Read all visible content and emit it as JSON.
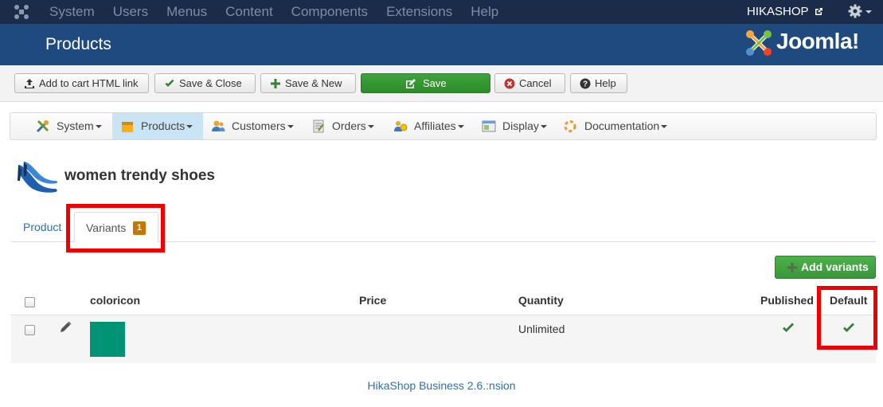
{
  "topbar": {
    "menu": [
      "System",
      "Users",
      "Menus",
      "Content",
      "Components",
      "Extensions",
      "Help"
    ],
    "site_name": "HIKASHOP"
  },
  "header": {
    "title": "Products",
    "brand": "Joomla!"
  },
  "toolbar": {
    "add_to_cart": "Add to cart HTML link",
    "save_close": "Save & Close",
    "save_new": "Save & New",
    "save": "Save",
    "cancel": "Cancel",
    "help": "Help"
  },
  "hikamenu": {
    "items": [
      "System",
      "Products",
      "Customers",
      "Orders",
      "Affiliates",
      "Display",
      "Documentation"
    ],
    "active": "Products"
  },
  "product": {
    "name": "women trendy shoes"
  },
  "tabs": {
    "product": "Product",
    "variants": "Variants",
    "variants_count": "1"
  },
  "variants": {
    "add_label": "Add variants",
    "columns": {
      "characteristic": "coloricon",
      "price": "Price",
      "quantity": "Quantity",
      "published": "Published",
      "default": "Default"
    },
    "rows": [
      {
        "swatch_color": "#009475",
        "price": "",
        "quantity": "Unlimited",
        "published": true,
        "default": true
      }
    ]
  },
  "footer": {
    "text": "HikaShop Business 2.6.:nsion"
  },
  "colors": {
    "topbar": "#1b2c4a",
    "header": "#1f4a80",
    "save_green": "#2e8a2b",
    "highlight_red": "#e00000",
    "link_blue": "#3071a9",
    "badge": "#c67605"
  }
}
